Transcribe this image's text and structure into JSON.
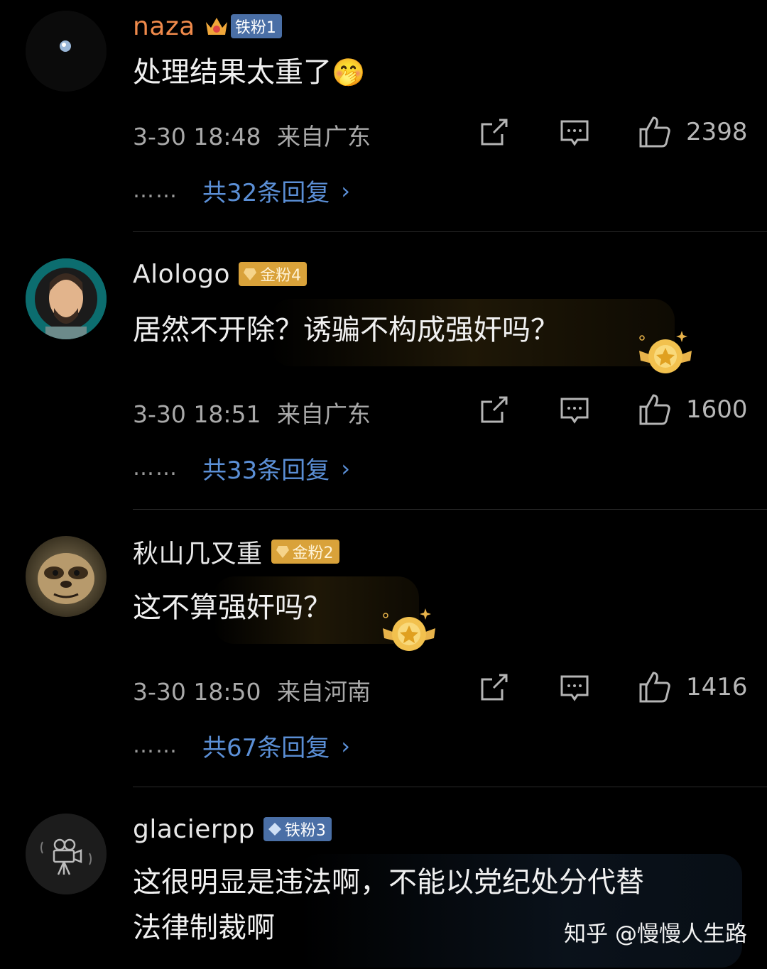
{
  "comments": [
    {
      "username": "naza",
      "badge": "铁粉1",
      "text": "处理结果太重了",
      "emoji": "🤭",
      "time": "3-30 18:48",
      "location": "来自广东",
      "likes": "2398",
      "reply_dots": "……",
      "replies": "共32条回复"
    },
    {
      "username": "Alologo",
      "badge": "金粉4",
      "text": "居然不开除？诱骗不构成强奸吗？",
      "time": "3-30 18:51",
      "location": "来自广东",
      "likes": "1600",
      "reply_dots": "……",
      "replies": "共33条回复"
    },
    {
      "username": "秋山几又重",
      "badge": "金粉2",
      "text": "这不算强奸吗？",
      "time": "3-30 18:50",
      "location": "来自河南",
      "likes": "1416",
      "reply_dots": "……",
      "replies": "共67条回复"
    },
    {
      "username": "glacierpp",
      "badge": "铁粉3",
      "text_line1": "这很明显是违法啊，不能以党纪处分代替",
      "text_line2": "法律制裁啊"
    }
  ],
  "watermark": "知乎 @慢慢人生路",
  "colors": {
    "background": "#000000",
    "reply_link": "#5b8fd6",
    "username_highlight": "#f08a4b",
    "iron_badge": "#4a6fa6",
    "gold_badge": "#d9a23a"
  },
  "icons": [
    "share-icon",
    "comment-icon",
    "like-icon",
    "chevron-right-icon",
    "medal-icon",
    "crown-icon",
    "gem-icon"
  ]
}
